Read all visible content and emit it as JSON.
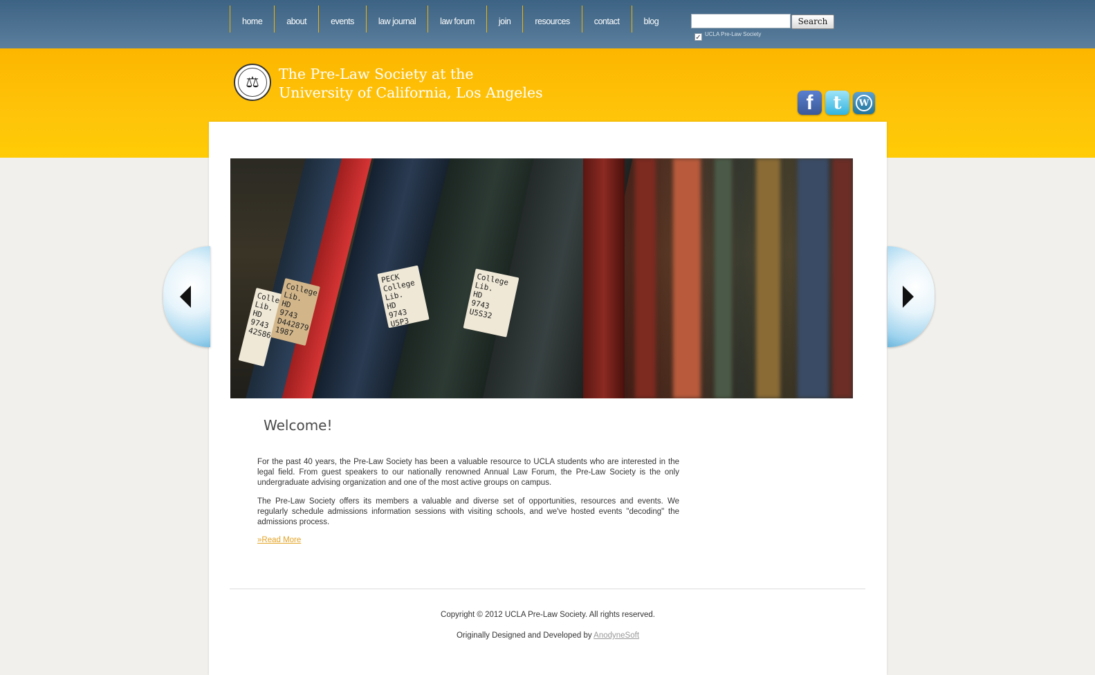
{
  "nav": {
    "items": [
      {
        "label": "home"
      },
      {
        "label": "about"
      },
      {
        "label": "events"
      },
      {
        "label": "law journal"
      },
      {
        "label": "law forum"
      },
      {
        "label": "join"
      },
      {
        "label": "resources"
      },
      {
        "label": "contact"
      },
      {
        "label": "blog"
      }
    ]
  },
  "search": {
    "value": "",
    "button_label": "Search",
    "site_option_label": "UCLA Pre-Law Society",
    "site_option_checked": true
  },
  "header": {
    "title_line1": "The Pre-Law Society at the",
    "title_line2": "University of California, Los Angeles",
    "social": [
      {
        "name": "facebook-icon",
        "glyph": "f"
      },
      {
        "name": "twitter-icon",
        "glyph": "t"
      },
      {
        "name": "wordpress-icon",
        "glyph": "W"
      }
    ]
  },
  "slideshow": {
    "labels": [
      "College\nLib.\nHD\n9743\nD442879\n1987",
      "PECK\nCollege\nLib.\nHD\n9743\nU5P3",
      "College\nLib.\nHD\n9743\nU5S32",
      "College\nLib.\nHD\n9743\n42S86"
    ]
  },
  "content": {
    "heading": "Welcome!",
    "paragraph1": "For the past 40 years, the Pre-Law Society has been a valuable resource to UCLA students who are interested in the legal field. From guest speakers to our nationally renowned Annual Law Forum, the Pre-Law Society is the only undergraduate advising organization and one of the most active groups on campus.",
    "paragraph2": "The Pre-Law Society offers its members a valuable and diverse set of opportunities, resources and events. We regularly schedule admissions information sessions with visiting schools, and we've hosted events \"decoding\" the admissions process.",
    "read_more": "»Read More"
  },
  "footer": {
    "copyright": "Copyright © 2012 UCLA Pre-Law Society. All rights reserved.",
    "credit_prefix": "Originally Designed and Developed by ",
    "credit_link": "AnodyneSoft"
  },
  "colors": {
    "nav_bg": "#4a6e8e",
    "accent_yellow": "#fdb600",
    "link_gold": "#e3a325"
  }
}
